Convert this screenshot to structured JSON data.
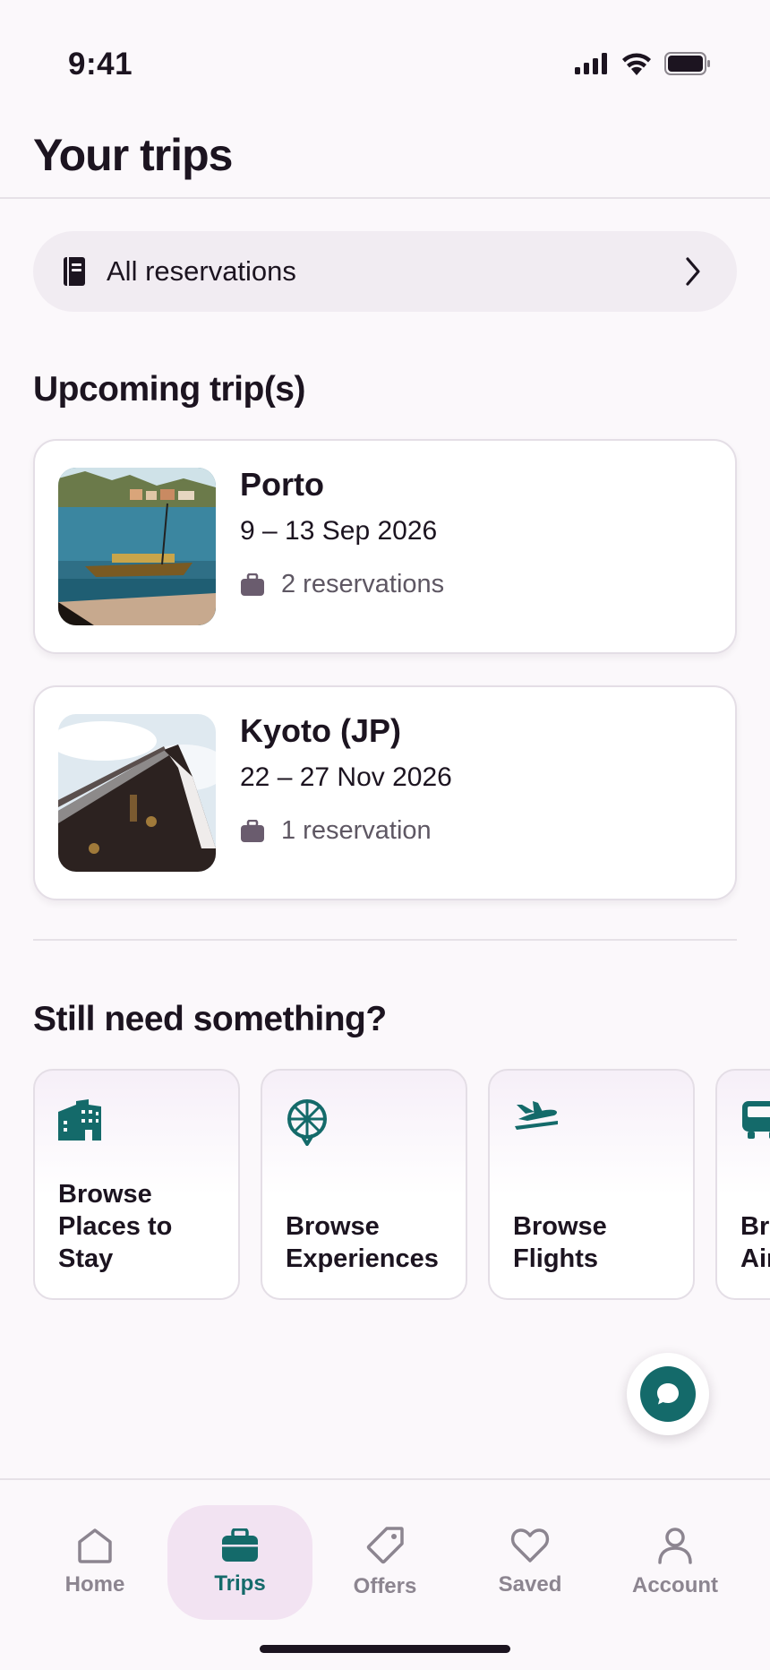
{
  "status_bar": {
    "time": "9:41"
  },
  "header": {
    "title": "Your trips"
  },
  "all_reservations": {
    "label": "All reservations"
  },
  "upcoming": {
    "title": "Upcoming trip(s)",
    "trips": [
      {
        "city": "Porto",
        "dates": "9 – 13 Sep 2026",
        "reservations": "2 reservations"
      },
      {
        "city": "Kyoto (JP)",
        "dates": "22 – 27 Nov 2026",
        "reservations": "1 reservation"
      }
    ]
  },
  "browse": {
    "title": "Still need something?",
    "cards": [
      {
        "label": "Browse Places to Stay",
        "icon": "buildings-icon"
      },
      {
        "label": "Browse Experiences",
        "icon": "ferris-wheel-icon"
      },
      {
        "label": "Browse Flights",
        "icon": "plane-icon"
      },
      {
        "label": "Browse Airport Rides",
        "icon": "bus-icon"
      }
    ]
  },
  "nav": {
    "items": [
      {
        "label": "Home",
        "icon": "home-icon"
      },
      {
        "label": "Trips",
        "icon": "suitcase-icon",
        "active": true
      },
      {
        "label": "Offers",
        "icon": "tag-icon"
      },
      {
        "label": "Saved",
        "icon": "heart-icon"
      },
      {
        "label": "Account",
        "icon": "person-icon"
      }
    ]
  },
  "colors": {
    "accent": "#146a6a",
    "active_pill": "#f2e3f2",
    "background": "#fbf8fb",
    "text": "#1c1420",
    "muted": "#8c8590"
  }
}
